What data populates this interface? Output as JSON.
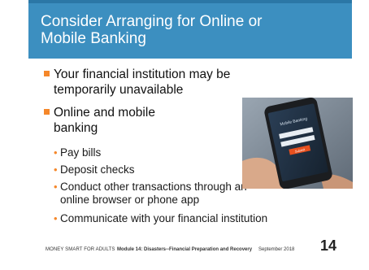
{
  "slide": {
    "title_line1": "Consider Arranging for Online or",
    "title_line2": "Mobile Banking",
    "bullets": [
      {
        "line1": "Your financial institution may be",
        "line2": "temporarily unavailable"
      },
      {
        "line1": "Online and mobile",
        "line2": "banking"
      }
    ],
    "sub_bullets": [
      {
        "line1": "Pay bills",
        "line2": ""
      },
      {
        "line1": "Deposit checks",
        "line2": ""
      },
      {
        "line1": "Conduct other transactions through an",
        "line2": "online browser or phone app"
      },
      {
        "line1": "Communicate with your financial institution",
        "line2": ""
      }
    ],
    "phone_screen": {
      "heading": "Mobile Banking",
      "button": "Submit"
    }
  },
  "footer": {
    "program": "MONEY SMART FOR ADULTS",
    "module": "Module 14: Disasters--Financial Preparation and Recovery",
    "date": "September 2018",
    "page_number": "14"
  },
  "colors": {
    "title_band": "#3c8fc0",
    "bullet_accent": "#f5872a",
    "phone_button": "#e8501e"
  }
}
